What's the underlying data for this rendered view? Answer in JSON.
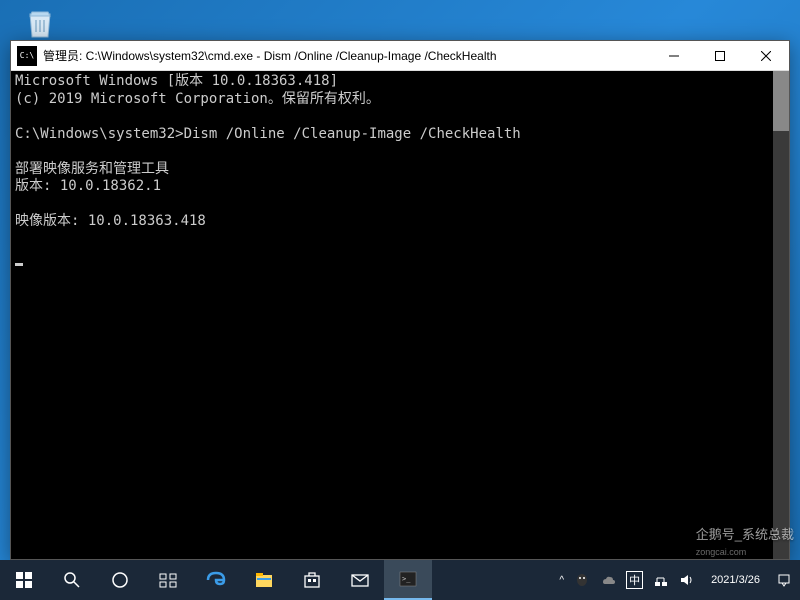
{
  "desktop": {
    "recycle_bin_label": "回收站"
  },
  "window": {
    "icon_text": "C:\\",
    "title": "管理员: C:\\Windows\\system32\\cmd.exe - Dism  /Online /Cleanup-Image /CheckHealth"
  },
  "terminal": {
    "line1": "Microsoft Windows [版本 10.0.18363.418]",
    "line2": "(c) 2019 Microsoft Corporation。保留所有权利。",
    "blank1": "",
    "prompt": "C:\\Windows\\system32>",
    "command": "Dism /Online /Cleanup-Image /CheckHealth",
    "blank2": "",
    "line3": "部署映像服务和管理工具",
    "line4": "版本: 10.0.18362.1",
    "blank3": "",
    "line5": "映像版本: 10.0.18363.418",
    "blank4": ""
  },
  "taskbar": {
    "start": "开始",
    "search": "搜索",
    "cortana": "Cortana",
    "taskview": "任务视图",
    "edge": "Microsoft Edge",
    "explorer": "文件资源管理器",
    "store": "Microsoft Store",
    "mail": "邮件",
    "cmd": "命令提示符"
  },
  "systray": {
    "chevron": "^",
    "ime": "中",
    "network": "网络",
    "volume": "音量",
    "date": "2021/3/26"
  },
  "watermark": {
    "text": "企鹅号_系统总裁",
    "sub": "zongcai.com"
  }
}
